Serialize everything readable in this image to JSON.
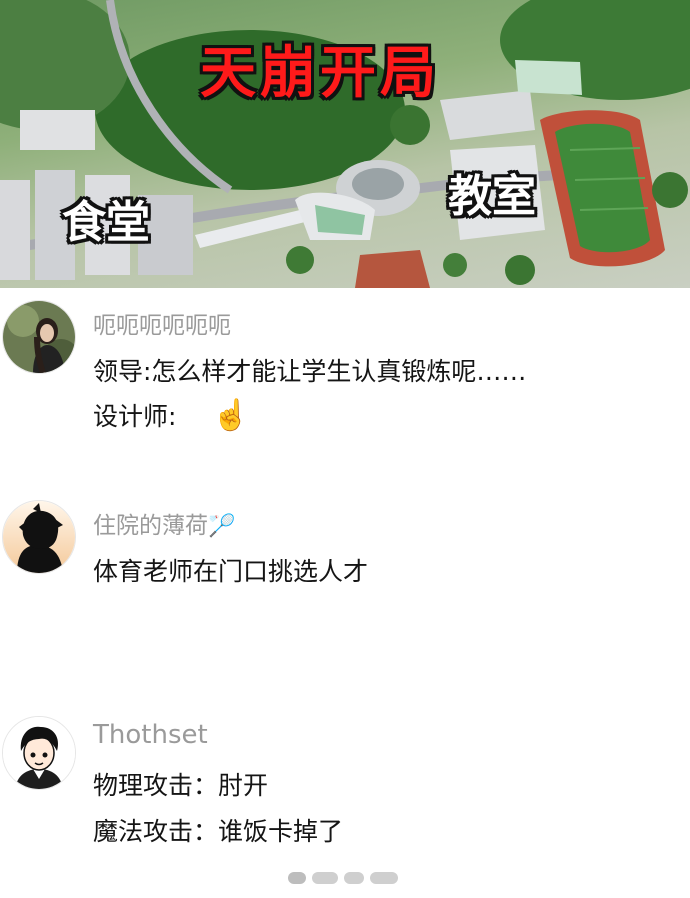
{
  "hero": {
    "title": "天崩开局",
    "label_canteen": "食堂",
    "label_classroom": "教室"
  },
  "comments": [
    {
      "username": "呃呃呃呃呃呃",
      "lines": [
        "领导:怎么样才能让学生认真锻炼呢……",
        "设计师:"
      ],
      "emoji": "☝️",
      "avatar_icon": "girl-photo-avatar"
    },
    {
      "username": "住院的薄荷",
      "username_emoji": "🏸",
      "lines": [
        "体育老师在门口挑选人才"
      ],
      "avatar_icon": "anime-silhouette-avatar"
    },
    {
      "username": "Thothset",
      "lines": [
        "物理攻击：肘开",
        "魔法攻击：谁饭卡掉了"
      ],
      "avatar_icon": "cartoon-boy-avatar"
    }
  ],
  "colors": {
    "title_red": "#ff1a1a",
    "username_gray": "#9a9a9a",
    "text_black": "#151515",
    "track_red": "#c0503a",
    "field_green": "#3f8a3a"
  }
}
